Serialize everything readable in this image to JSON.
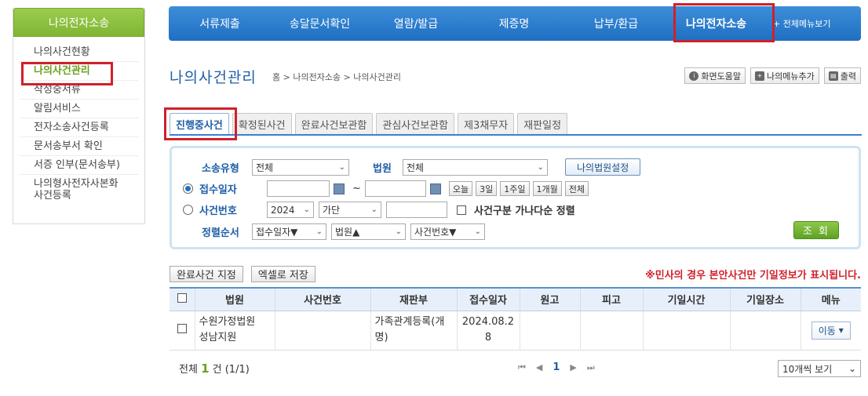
{
  "sidebar": {
    "title": "나의전자소송",
    "items": [
      "나의사건현황",
      "나의사건관리",
      "작성중서류",
      "알림서비스",
      "전자소송사건등록",
      "문서송부서 확인",
      "서증 인부(문서송부)",
      "나의형사전자사본화\n사건등록"
    ]
  },
  "topnav": {
    "items": [
      "서류제출",
      "송달문서확인",
      "열람/발급",
      "제증명",
      "납부/환급",
      "나의전자소송"
    ],
    "all_menu": "+ 전체메뉴보기"
  },
  "page": {
    "title": "나의사건관리",
    "breadcrumb": "홈 > 나의전자소송 > 나의사건관리",
    "help": "화면도움말",
    "add_menu": "나의메뉴추가",
    "print": "출력"
  },
  "tabs": [
    "진행중사건",
    "확정된사건",
    "완료사건보관함",
    "관심사건보관함",
    "제3채무자",
    "재판일정"
  ],
  "search": {
    "type_label": "소송유형",
    "type_value": "전체",
    "court_label": "법원",
    "court_value": "전체",
    "court_setting": "나의법원설정",
    "date_label": "접수일자",
    "tilde": "~",
    "quick": [
      "오늘",
      "3일",
      "1주일",
      "1개월",
      "전체"
    ],
    "case_label": "사건번호",
    "year_value": "2024",
    "gubun_value": "가단",
    "sort_check_label": "사건구분 가나다순 정렬",
    "order_label": "정렬순서",
    "order1": "접수일자▼",
    "order2": "법원▲",
    "order3": "사건번호▼",
    "search_btn": "조 회"
  },
  "actions": {
    "complete": "완료사건 지정",
    "excel": "엑셀로 저장",
    "notice": "※민사의 경우 본안사건만 기일정보가 표시됩니다."
  },
  "table": {
    "headers": [
      "법원",
      "사건번호",
      "재판부",
      "접수일자",
      "원고",
      "피고",
      "기일시간",
      "기일장소",
      "메뉴"
    ],
    "rows": [
      {
        "court": "수원가정법원\n성남지원",
        "case_no": "",
        "division": "가족관계등록(개\n명)",
        "date": "2024.08.2\n8",
        "plaintiff": "",
        "defendant": "",
        "time": "",
        "place": "",
        "menu": "이동"
      }
    ]
  },
  "footer": {
    "total_prefix": "전체",
    "total_count": "1",
    "total_suffix": "건 (1/1)",
    "page": "1",
    "per_page": "10개씩 보기"
  }
}
